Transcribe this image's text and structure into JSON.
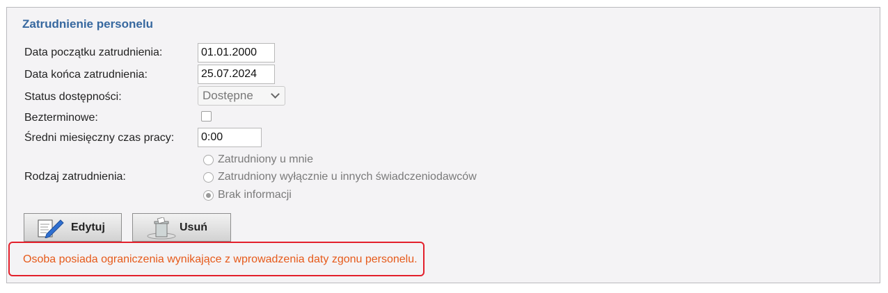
{
  "section": {
    "title": "Zatrudnienie personelu"
  },
  "fields": {
    "start_date": {
      "label": "Data początku zatrudnienia:",
      "value": "01.01.2000"
    },
    "end_date": {
      "label": "Data końca zatrudnienia:",
      "value": "25.07.2024"
    },
    "availability_status": {
      "label": "Status dostępności:",
      "value": "Dostępne"
    },
    "indefinite": {
      "label": "Bezterminowe:",
      "checked": false
    },
    "avg_monthly_hours": {
      "label": "Średni miesięczny czas pracy:",
      "value": "0:00"
    },
    "employment_type": {
      "label": "Rodzaj zatrudnienia:",
      "options": [
        "Zatrudniony u mnie",
        "Zatrudniony wyłącznie u innych świadczeniodawców",
        "Brak informacji"
      ],
      "selected": "Brak informacji"
    }
  },
  "buttons": {
    "edit": "Edytuj",
    "delete": "Usuń"
  },
  "icons": {
    "edit": "edit-pencil-icon",
    "delete": "trash-can-icon"
  },
  "alert": {
    "text": "Osoba posiada ograniczenia wynikające z wprowadzenia daty zgonu personelu.",
    "border_color": "#e3202b",
    "text_color": "#e65a1a"
  },
  "colors": {
    "title": "#37689f",
    "panel_bg": "#f4f3f5"
  }
}
